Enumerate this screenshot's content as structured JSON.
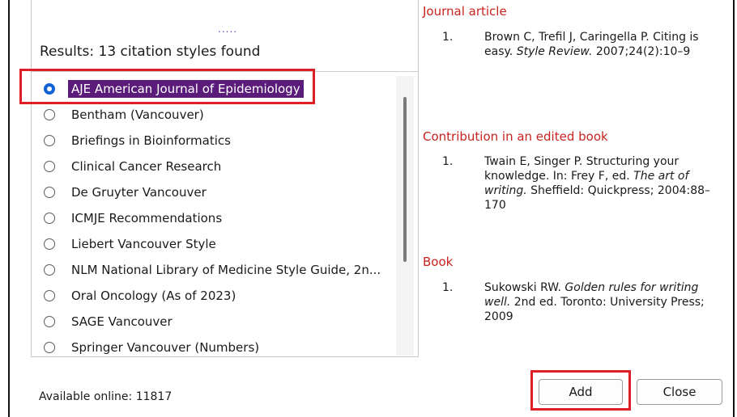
{
  "results": {
    "title": "Results: 13 citation styles found",
    "drag_handle": "....."
  },
  "styles": [
    {
      "label": "AJE American Journal of Epidemiology",
      "selected": true
    },
    {
      "label": "Bentham (Vancouver)",
      "selected": false
    },
    {
      "label": "Briefings in Bioinformatics",
      "selected": false
    },
    {
      "label": "Clinical Cancer Research",
      "selected": false
    },
    {
      "label": "De Gruyter Vancouver",
      "selected": false
    },
    {
      "label": "ICMJE Recommendations",
      "selected": false
    },
    {
      "label": "Liebert Vancouver Style",
      "selected": false
    },
    {
      "label": "NLM National Library of Medicine Style Guide, 2n...",
      "selected": false
    },
    {
      "label": "Oral Oncology (As of 2023)",
      "selected": false
    },
    {
      "label": "SAGE Vancouver",
      "selected": false
    },
    {
      "label": "Springer Vancouver (Numbers)",
      "selected": false
    }
  ],
  "preview": {
    "journal": {
      "heading": "Journal article",
      "num": "1.",
      "pre": "Brown C, Trefil J, Caringella P. Citing is easy. ",
      "italic": "Style Review.",
      "post": " 2007;24(2):10–9"
    },
    "edited": {
      "heading": "Contribution in an edited book",
      "num": "1.",
      "pre": "Twain E, Singer P. Structuring your knowledge. In: Frey F, ed. ",
      "italic": "The art of writing.",
      "post": " Sheffield: Quickpress; 2004:88–170"
    },
    "book": {
      "heading": "Book",
      "num": "1.",
      "pre": "Sukowski RW. ",
      "italic": "Golden rules for writing well.",
      "post": " 2nd ed. Toronto: University Press; 2009"
    }
  },
  "footer": {
    "available": "Available online: 11817",
    "add_label": "Add",
    "close_label": "Close"
  },
  "colors": {
    "selection": "#5b1b7a",
    "radio_selected": "#1261d6",
    "heading": "#c8231e",
    "highlight": "#e01e26"
  }
}
